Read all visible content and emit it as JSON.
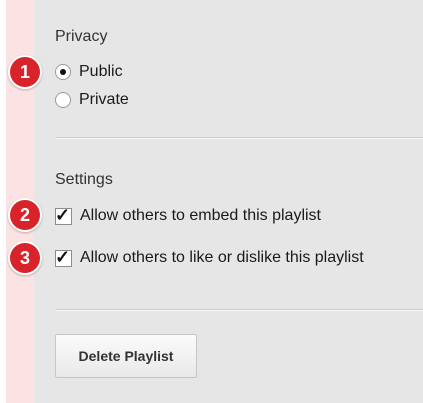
{
  "privacy": {
    "title": "Privacy",
    "options": [
      {
        "label": "Public",
        "selected": true
      },
      {
        "label": "Private",
        "selected": false
      }
    ]
  },
  "settings": {
    "title": "Settings",
    "options": [
      {
        "label": "Allow others to embed this playlist",
        "checked": true
      },
      {
        "label": "Allow others to like or dislike this playlist",
        "checked": true
      }
    ]
  },
  "badges": [
    "1",
    "2",
    "3"
  ],
  "actions": {
    "delete_label": "Delete Playlist"
  },
  "colors": {
    "badge": "#d8232a",
    "panel": "#e6e6e6",
    "stripe": "#fbe3e3"
  }
}
